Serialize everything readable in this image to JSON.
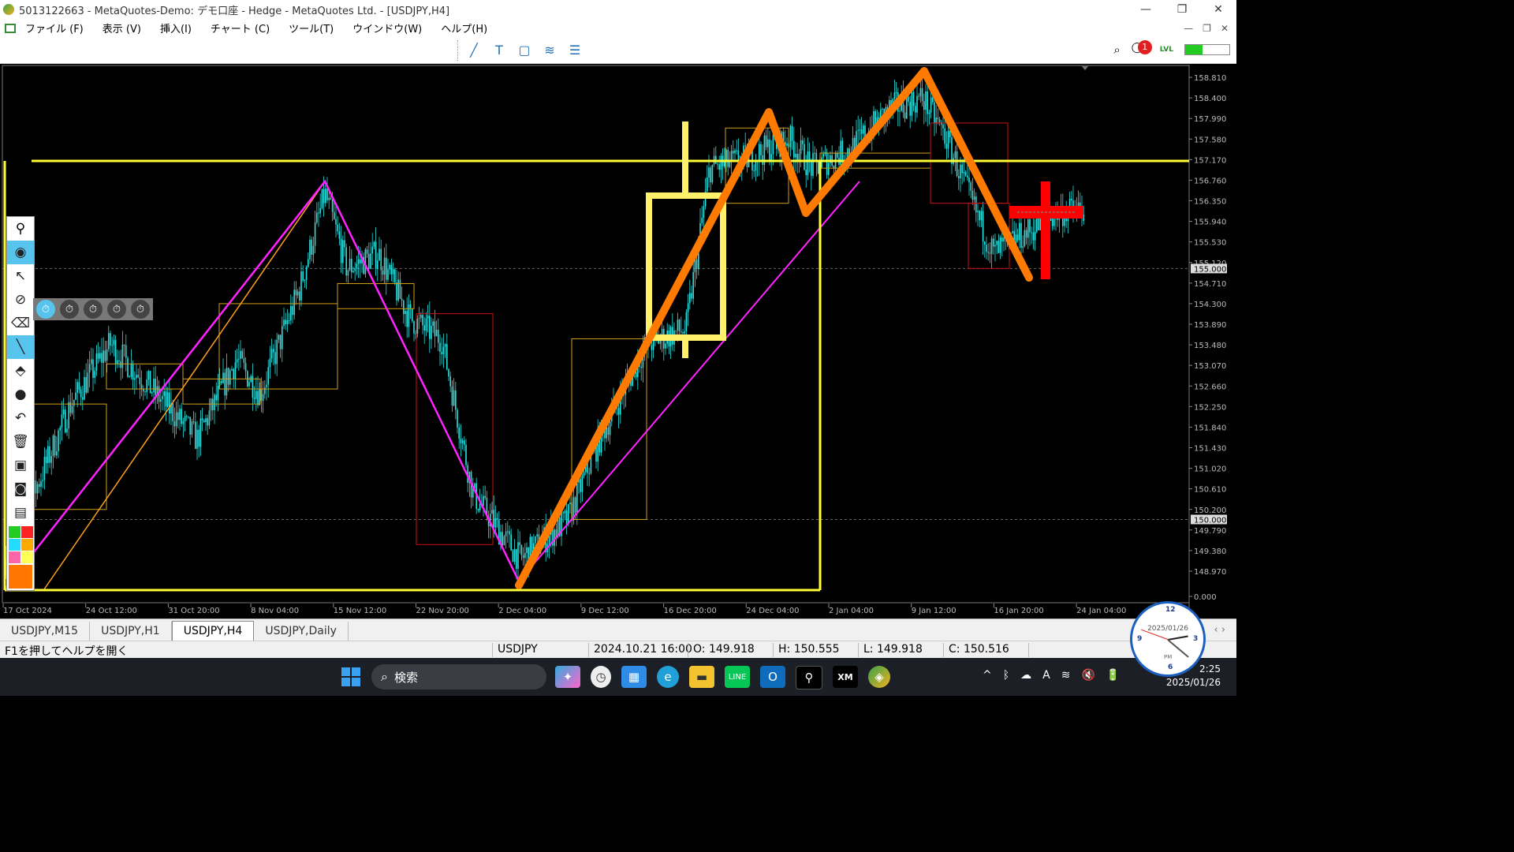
{
  "window": {
    "title": "5013122663 - MetaQuotes-Demo: デモ口座 - Hedge - MetaQuotes Ltd. - [USDJPY,H4]",
    "controls": [
      "—",
      "❐",
      "✕"
    ]
  },
  "menu": {
    "items": [
      "ファイル (F)",
      "表示 (V)",
      "挿入(I)",
      "チャート (C)",
      "ツール(T)",
      "ウインドウ(W)",
      "ヘルプ(H)"
    ],
    "mdi_controls": [
      "—",
      "❐",
      "✕"
    ]
  },
  "toolbar": {
    "tools": [
      "line-tool-icon",
      "text-tool-icon",
      "rectangle-tool-icon",
      "fibonacci-tool-icon",
      "channel-tool-icon"
    ],
    "notification_count": "1",
    "lvl_label": "LVL",
    "signal_strength": 0.4
  },
  "chart": {
    "symbol": "USDJPY",
    "timeframe": "H4",
    "price_labels": [
      "158.810",
      "158.400",
      "157.990",
      "157.580",
      "157.170",
      "156.760",
      "156.350",
      "155.940",
      "155.530",
      "155.120",
      "154.710",
      "154.300",
      "153.890",
      "153.480",
      "153.070",
      "152.660",
      "152.250",
      "151.840",
      "151.430",
      "151.020",
      "150.610",
      "150.200",
      "149.790",
      "149.380",
      "148.970",
      "0.000"
    ],
    "highlight_prices": [
      "155.000",
      "150.000"
    ],
    "time_labels": [
      "17 Oct 2024",
      "24 Oct 12:00",
      "31 Oct 20:00",
      "8 Nov 04:00",
      "15 Nov 12:00",
      "22 Nov 20:00",
      "2 Dec 04:00",
      "9 Dec 12:00",
      "16 Dec 20:00",
      "24 Dec 04:00",
      "2 Jan 04:00",
      "9 Jan 12:00",
      "16 Jan 20:00",
      "24 Jan 04:00"
    ],
    "colors": {
      "zigzag": "#ff7a00",
      "trend": "#ff22ff",
      "boxes": "#d4a017",
      "red_boxes": "#cc1111",
      "candles": "#28e0e0",
      "hline": "#ffff33",
      "big_candle": "#fff16a",
      "cross": "#ff0000"
    }
  },
  "drawing_panel": {
    "tools": [
      "pin-icon",
      "eye-icon",
      "cursor-icon",
      "stopwatch-icon",
      "eraser-icon",
      "pen-icon",
      "ruler-icon",
      "dot-icon",
      "undo-icon",
      "trash-icon",
      "projector-icon",
      "camera-icon",
      "clipboard-icon"
    ],
    "swatches": [
      "#22cc22",
      "#ff2222",
      "#22ddff",
      "#ffaa00",
      "#ff66aa",
      "#ffff55"
    ],
    "active_color": "#ff7700"
  },
  "timers": [
    "⏱",
    "⏱",
    "⏱",
    "⏱",
    "⏱"
  ],
  "tabs": [
    "USDJPY,M15",
    "USDJPY,H1",
    "USDJPY,H4",
    "USDJPY,Daily"
  ],
  "active_tab": 2,
  "status": {
    "help": "F1を押してヘルプを開く",
    "symbol": "USDJPY",
    "datetime": "2024.10.21 16:00",
    "open": "O: 149.918",
    "high": "H: 150.555",
    "low": "L: 149.918",
    "close": "C: 150.516"
  },
  "taskbar": {
    "search_placeholder": "検索",
    "apps": [
      "copilot-icon",
      "clock-icon",
      "files-icon",
      "edge-icon",
      "folder-icon",
      "line-icon",
      "outlook-icon",
      "metaquotes-icon",
      "xm-icon",
      "metatrader-icon"
    ],
    "time": "2:25",
    "date": "2025/01/26",
    "tray": [
      "^",
      "ᛒ",
      "☁",
      "A",
      "≋",
      "🔇",
      "🔋"
    ]
  },
  "analog_clock": {
    "date": "2025/01/26",
    "ampm": "PM"
  }
}
